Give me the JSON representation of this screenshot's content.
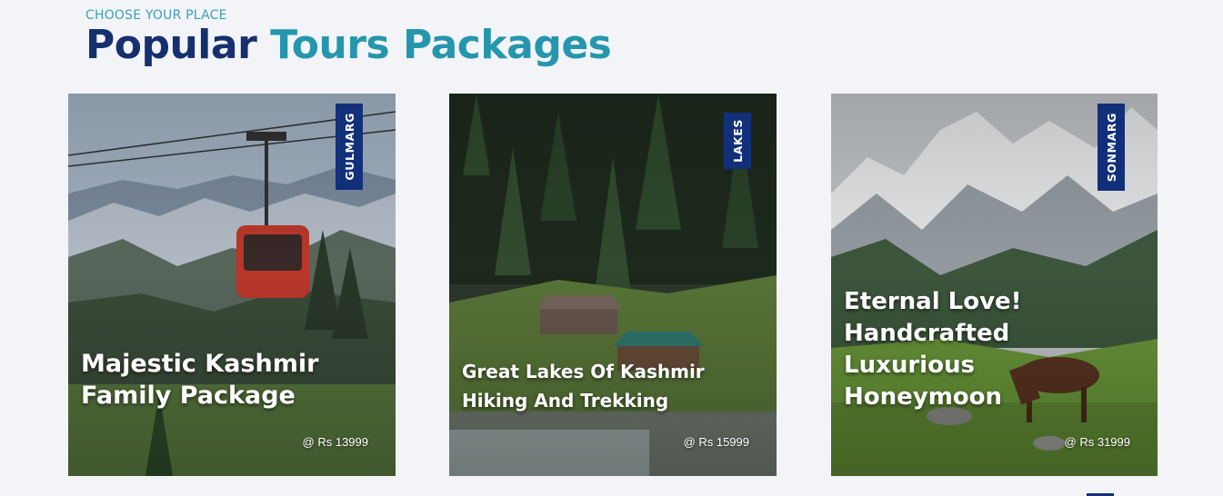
{
  "section": {
    "eyebrow": "CHOOSE YOUR PLACE",
    "title_part1": "Popular",
    "title_part2": "Tours Packages"
  },
  "cards": [
    {
      "tag": "GULMARG",
      "title_lines": [
        "Majestic Kashmir",
        "Family Package"
      ],
      "price": "@ Rs 13999",
      "scene": "gondola-mountain"
    },
    {
      "tag": "LAKES",
      "title_lines": [
        "Great Lakes Of Kashmir",
        "Hiking And Trekking"
      ],
      "price": "@ Rs 15999",
      "scene": "forest-cabins"
    },
    {
      "tag": "SONMARG",
      "title_lines": [
        "Eternal Love!",
        "Handcrafted",
        "Luxurious",
        "Honeymoon"
      ],
      "price": "@ Rs 31999",
      "scene": "snow-peaks-horse"
    }
  ],
  "colors": {
    "navy": "#16306f",
    "teal": "#2596ad",
    "tag_bg": "#12307a",
    "page_bg": "#f3f4f8"
  }
}
